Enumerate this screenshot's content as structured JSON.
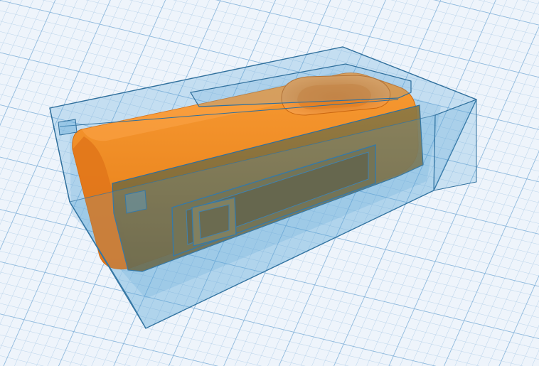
{
  "scene": {
    "description_visible_text": "",
    "colors": {
      "workplane_background": "#eef4fb",
      "grid_minor": "#b9d3ea",
      "grid_major": "#7fb0d8",
      "hole_fill": "#5aa6d6",
      "hole_stroke": "#2f6f9c",
      "solid_body": "#f28a24",
      "solid_shadow": "#c26a12",
      "overlap_body": "#7f6c3c",
      "overlap_inset": "#6a5a30"
    },
    "objects": [
      {
        "name": "transparent-hole-box",
        "kind": "hole"
      },
      {
        "name": "rounded-solid-body",
        "kind": "solid"
      },
      {
        "name": "inset-slot-cutout",
        "kind": "hole"
      },
      {
        "name": "small-square-cutout",
        "kind": "hole"
      },
      {
        "name": "circular-recess",
        "kind": "hole"
      },
      {
        "name": "top-rail",
        "kind": "hole"
      }
    ]
  }
}
